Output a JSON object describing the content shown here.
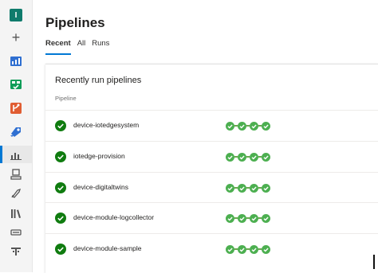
{
  "colors": {
    "accent": "#0078d4",
    "success": "#107c10",
    "rail_bg": "#f4f4f4"
  },
  "rail": {
    "org_initial": "I",
    "items": [
      {
        "icon": "organization-badge-icon"
      },
      {
        "icon": "plus-icon"
      },
      {
        "icon": "overview-icon"
      },
      {
        "icon": "boards-icon"
      },
      {
        "icon": "repos-icon"
      },
      {
        "icon": "pipelines-icon"
      },
      {
        "icon": "pipelines-list-icon"
      },
      {
        "icon": "environments-icon"
      },
      {
        "icon": "releases-icon"
      },
      {
        "icon": "library-icon"
      },
      {
        "icon": "task-groups-icon"
      },
      {
        "icon": "deployment-groups-icon"
      }
    ]
  },
  "page": {
    "title": "Pipelines",
    "tabs": [
      {
        "label": "Recent",
        "active": true
      },
      {
        "label": "All",
        "active": false
      },
      {
        "label": "Runs",
        "active": false
      }
    ]
  },
  "card": {
    "title": "Recently run pipelines",
    "column_header": "Pipeline",
    "rows": [
      {
        "name": "device-iotedgesystem",
        "status": "succeeded",
        "stages": [
          "succeeded",
          "succeeded",
          "succeeded",
          "succeeded"
        ]
      },
      {
        "name": "iotedge-provision",
        "status": "succeeded",
        "stages": [
          "succeeded",
          "succeeded",
          "succeeded",
          "succeeded"
        ]
      },
      {
        "name": "device-digitaltwins",
        "status": "succeeded",
        "stages": [
          "succeeded",
          "succeeded",
          "succeeded",
          "succeeded"
        ]
      },
      {
        "name": "device-module-logcollector",
        "status": "succeeded",
        "stages": [
          "succeeded",
          "succeeded",
          "succeeded",
          "succeeded"
        ]
      },
      {
        "name": "device-module-sample",
        "status": "succeeded",
        "stages": [
          "succeeded",
          "succeeded",
          "succeeded",
          "succeeded"
        ]
      }
    ]
  }
}
